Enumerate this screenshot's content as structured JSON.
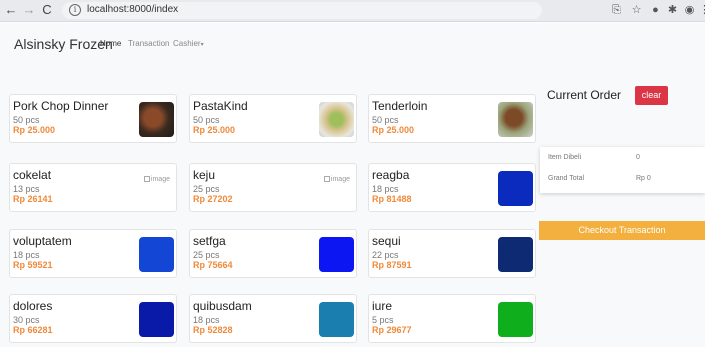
{
  "browser": {
    "url": "localhost:8000/index"
  },
  "navbar": {
    "brand": "Alsinsky Frozen",
    "links": [
      {
        "label": "Home"
      },
      {
        "label": "Transaction"
      },
      {
        "label": "Cashier"
      }
    ]
  },
  "products": [
    {
      "name": "Pork Chop Dinner",
      "qty": "50 pcs",
      "price": "Rp 25.000"
    },
    {
      "name": "PastaKind",
      "qty": "50 pcs",
      "price": "Rp 25.000"
    },
    {
      "name": "Tenderloin",
      "qty": "50 pcs",
      "price": "Rp 25.000"
    },
    {
      "name": "cokelat",
      "qty": "13 pcs",
      "price": "Rp 26141",
      "image_alt": "image"
    },
    {
      "name": "keju",
      "qty": "25 pcs",
      "price": "Rp 27202",
      "image_alt": "image"
    },
    {
      "name": "reagba",
      "qty": "18 pcs",
      "price": "Rp 81488",
      "color": "#0a2bbd"
    },
    {
      "name": "voluptatem",
      "qty": "18 pcs",
      "price": "Rp 59521",
      "color": "#1446d6"
    },
    {
      "name": "setfga",
      "qty": "25 pcs",
      "price": "Rp 75664",
      "color": "#0b16f2"
    },
    {
      "name": "sequi",
      "qty": "22 pcs",
      "price": "Rp 87591",
      "color": "#0d2a73"
    },
    {
      "name": "dolores",
      "qty": "30 pcs",
      "price": "Rp 66281",
      "color": "#0a1aa8"
    },
    {
      "name": "quibusdam",
      "qty": "18 pcs",
      "price": "Rp 52828",
      "color": "#1a7fae"
    },
    {
      "name": "iure",
      "qty": "5 pcs",
      "price": "Rp 29677",
      "color": "#0eae1c"
    }
  ],
  "order": {
    "title": "Current Order",
    "clear_label": "clear",
    "summary": [
      {
        "label": "Item Dibeli",
        "value": "0"
      },
      {
        "label": "Grand Total",
        "value": "Rp 0"
      }
    ],
    "checkout_label": "Checkout Transaction"
  }
}
